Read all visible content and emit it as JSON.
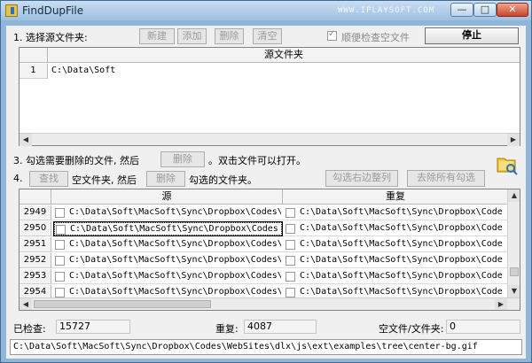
{
  "window": {
    "title": "FindDupFile",
    "watermark": "WWW.IPLAYSOFT.COM",
    "min_label": "—",
    "max_label": "□",
    "close_label": "✕"
  },
  "step1": {
    "label": "1. 选择源文件夹:",
    "btn_new": "新建",
    "btn_add": "添加",
    "btn_delete": "删除",
    "btn_clear": "清空",
    "check_empty_label": "顺便检查空文件",
    "btn_stop": "停止"
  },
  "source_grid": {
    "header": "源文件夹",
    "rows": [
      {
        "num": "1",
        "path": "C:\\Data\\Soft"
      }
    ]
  },
  "step3": {
    "label": "3. 勾选需要删除的文件, 然后",
    "btn_delete": "删除",
    "suffix": "。双击文件可以打开。"
  },
  "step4": {
    "label": "4.",
    "btn_find": "查找",
    "mid": "空文件夹, 然后",
    "btn_delete": "删除",
    "suffix": "勾选的文件夹。",
    "btn_check_right": "勾选右边整列",
    "btn_uncheck_all": "去除所有勾选"
  },
  "result_grid": {
    "header_source": "源",
    "header_dup": "重复",
    "rows": [
      {
        "num": "2949",
        "src": "C:\\Data\\Soft\\MacSoft\\Sync\\Dropbox\\Codes\\",
        "dup": "C:\\Data\\Soft\\MacSoft\\Sync\\Dropbox\\Code"
      },
      {
        "num": "2950",
        "src": "C:\\Data\\Soft\\MacSoft\\Sync\\Dropbox\\Codes",
        "dup": "C:\\Data\\Soft\\MacSoft\\Sync\\Dropbox\\Code"
      },
      {
        "num": "2951",
        "src": "C:\\Data\\Soft\\MacSoft\\Sync\\Dropbox\\Codes\\",
        "dup": "C:\\Data\\Soft\\MacSoft\\Sync\\Dropbox\\Code"
      },
      {
        "num": "2952",
        "src": "C:\\Data\\Soft\\MacSoft\\Sync\\Dropbox\\Codes\\",
        "dup": "C:\\Data\\Soft\\MacSoft\\Sync\\Dropbox\\Code"
      },
      {
        "num": "2953",
        "src": "C:\\Data\\Soft\\MacSoft\\Sync\\Dropbox\\Codes\\",
        "dup": "C:\\Data\\Soft\\MacSoft\\Sync\\Dropbox\\Code"
      },
      {
        "num": "2954",
        "src": "C:\\Data\\Soft\\MacSoft\\Sync\\Dropbox\\Codes\\",
        "dup": "C:\\Data\\Soft\\MacSoft\\Sync\\Dropbox\\Code"
      }
    ]
  },
  "stats": {
    "checked_label": "已检查:",
    "checked_value": "15727",
    "dup_label": "重复:",
    "dup_value": "4087",
    "empty_label": "空文件/文件夹:",
    "empty_value": "0"
  },
  "status_path": "C:\\Data\\Soft\\MacSoft\\Sync\\Dropbox\\Codes\\WebSites\\dlx\\js\\ext\\examples\\tree\\center-bg.gif",
  "icons": {
    "app": "app-icon",
    "folder_search": "folder-search-icon"
  }
}
